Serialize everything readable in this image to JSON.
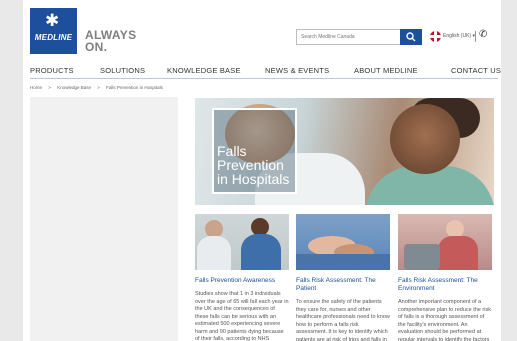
{
  "brand": {
    "logo_text": "MEDLINE",
    "tagline": "ALWAYS\nON."
  },
  "header": {
    "search_placeholder": "Search Medline Canada",
    "language": "English (UK) ▾",
    "phone_glyph": "✆"
  },
  "nav": [
    "PRODUCTS",
    "SOLUTIONS",
    "KNOWLEDGE BASE",
    "NEWS & EVENTS",
    "ABOUT MEDLINE",
    "CONTACT US"
  ],
  "breadcrumb": [
    "Home",
    ">",
    "Knowledge Base",
    ">",
    "Falls Prevention in Hospitals"
  ],
  "hero": {
    "title": "Falls\nPrevention\nin Hospitals"
  },
  "cards": [
    {
      "title": "Falls Prevention Awareness",
      "text": "Studies show that 1 in 3 individuals over the age of 65 will fall each year in the UK and the consequences of these falls can be serious with an estimated 500 experiencing severe harm and 90 patients dying because of their falls, according to NHS"
    },
    {
      "title": "Falls Risk Assessment: The Patient",
      "text": "To ensure the safety of the patients they care for, nurses and other healthcare professionals need to know how to perform a falls risk assessment. It is key to identify which patients are at risk of trips and falls in a facility."
    },
    {
      "title": "Falls Risk Assessment: The Environment",
      "text": "Another important component of a comprehensive plan to reduce the risk of falls is a thorough assessment of the facility's environment. An evaluation should be performed at regular intervals to identify the factors that could cause patients to fall"
    }
  ],
  "colors": {
    "brand_blue": "#1d4f9c",
    "nav_text": "#333333",
    "link_blue": "#1d4f9c"
  }
}
